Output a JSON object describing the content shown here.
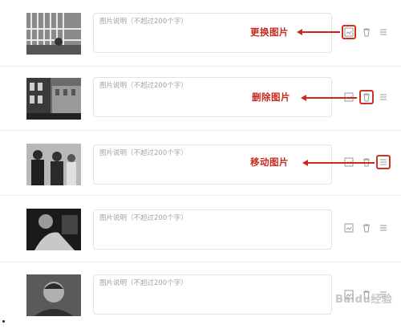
{
  "placeholder": "图片说明（不超过200个字）",
  "annotations": {
    "replace": "更换图片",
    "delete": "删除图片",
    "move": "移动图片"
  },
  "watermark": "Baidu经验",
  "icons": [
    "replace-image-icon",
    "trash-icon",
    "drag-handle-icon"
  ],
  "colors": {
    "annotation": "#c8281e",
    "icon": "#9a9a9a",
    "border": "#e2e2e2"
  }
}
